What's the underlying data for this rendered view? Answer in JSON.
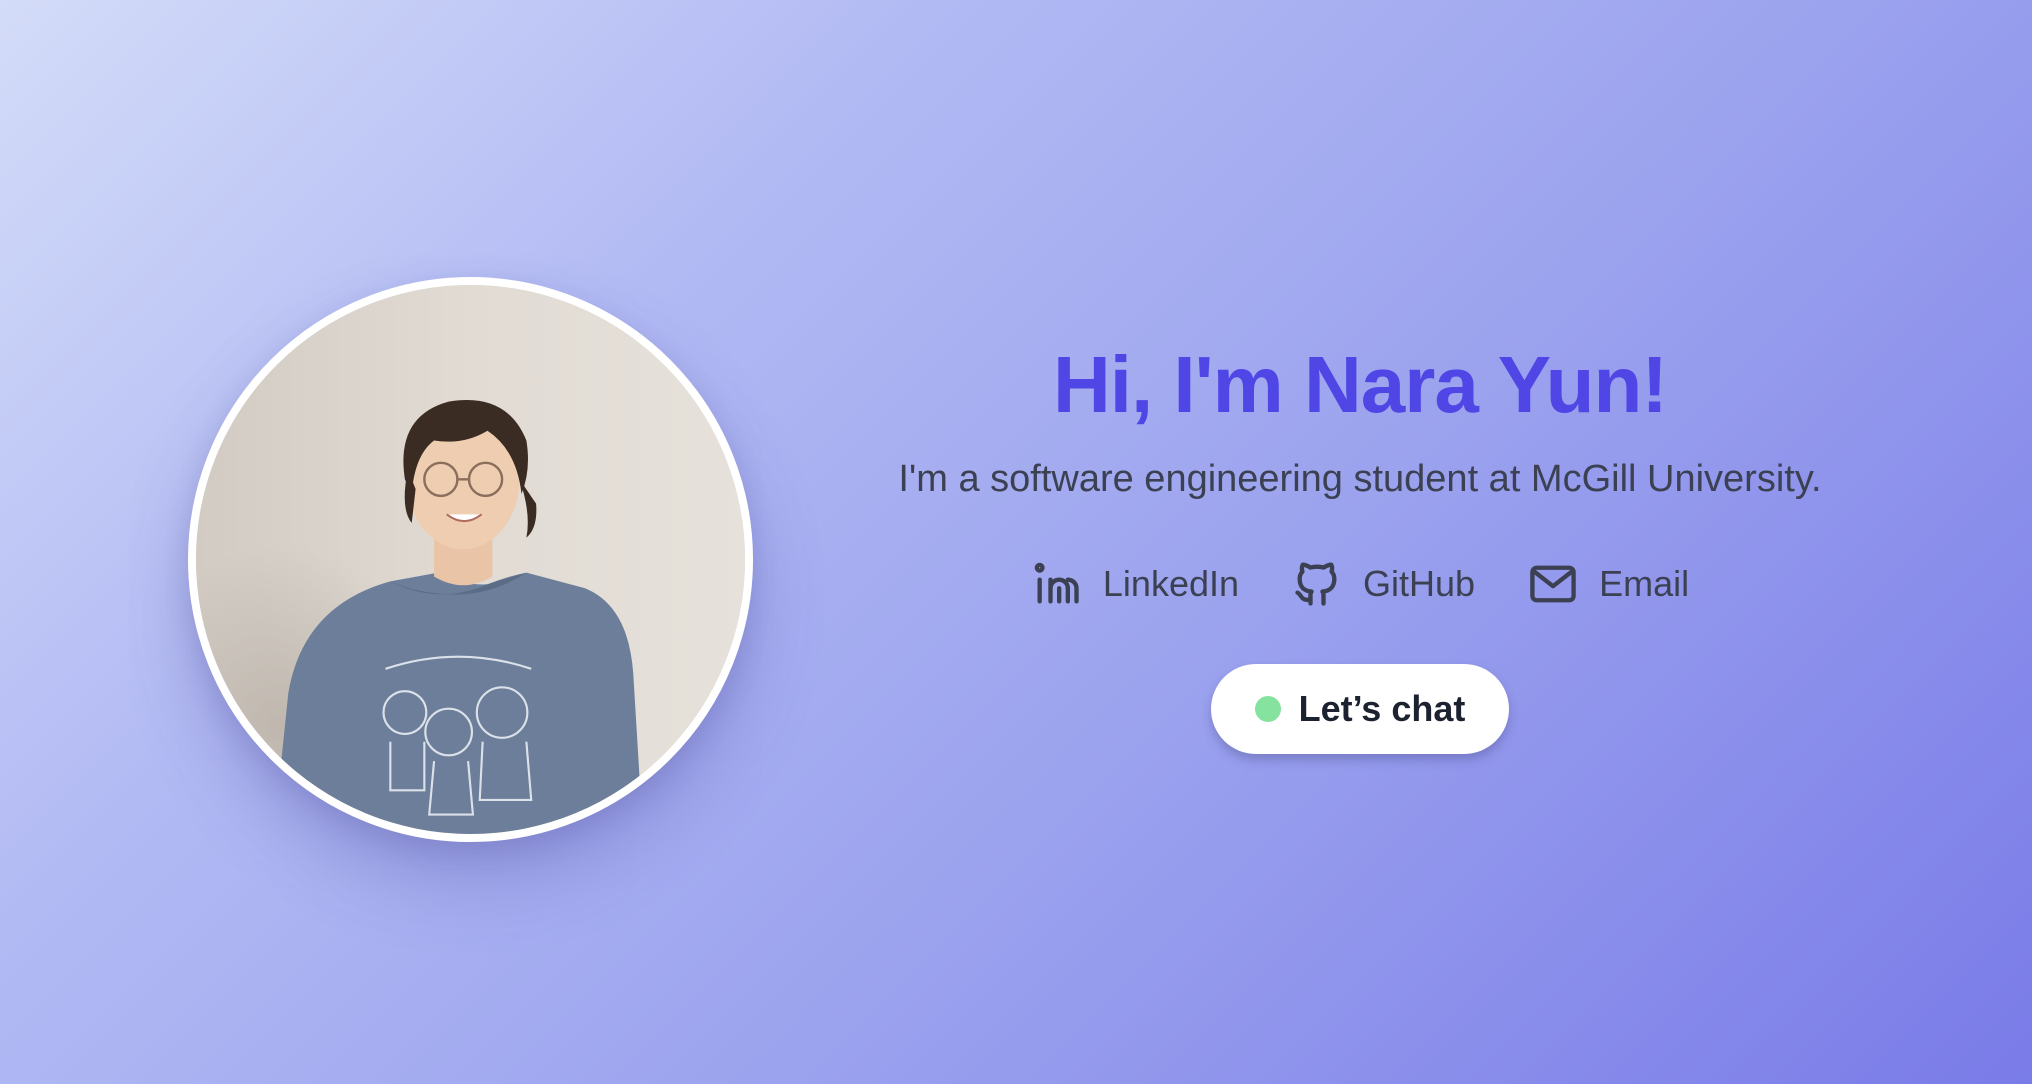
{
  "hero": {
    "title": "Hi, I'm Nara Yun!",
    "subtitle": "I'm a software engineering student at McGill University.",
    "links": [
      {
        "label": "LinkedIn",
        "icon": "linkedin-icon"
      },
      {
        "label": "GitHub",
        "icon": "github-icon"
      },
      {
        "label": "Email",
        "icon": "mail-icon"
      }
    ],
    "cta": {
      "label": "Let’s chat",
      "status_color": "#86e29f"
    }
  },
  "colors": {
    "accent": "#4f46e5",
    "text": "#3b4152",
    "background_start": "#d3dcf8",
    "background_end": "#7a7be8"
  }
}
